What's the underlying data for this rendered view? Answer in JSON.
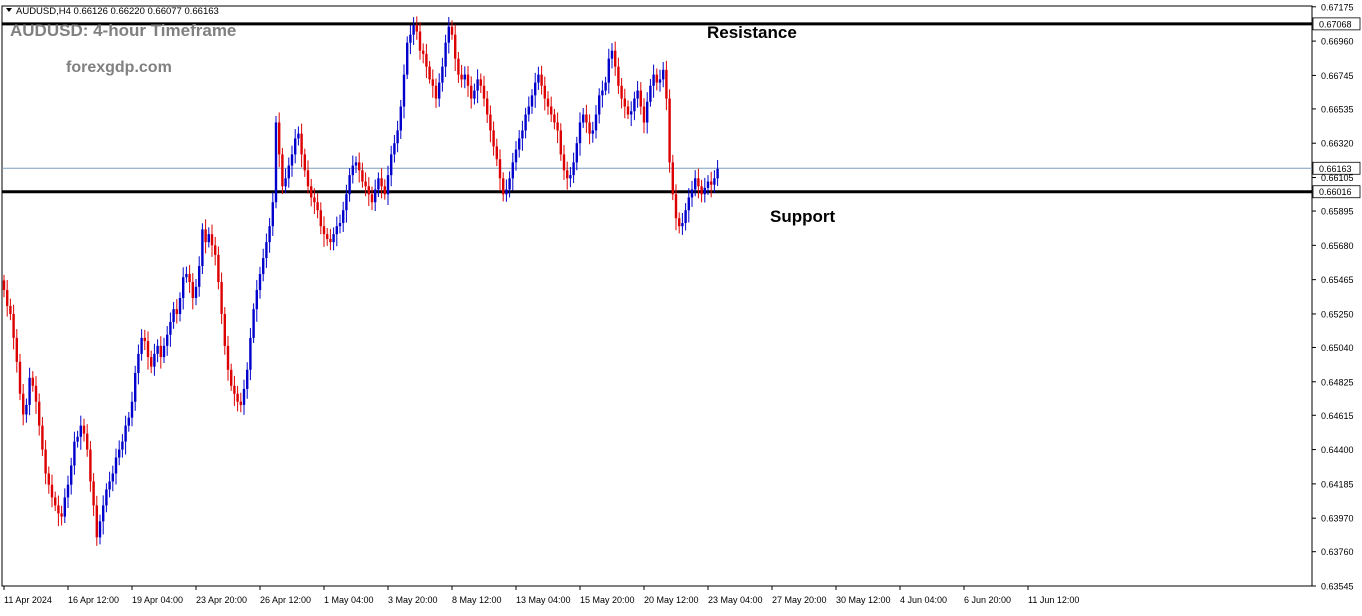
{
  "header": {
    "symbol_line": "AUDUSD,H4  0.66126 0.66220 0.66077 0.66163",
    "chart_title": "AUDUSD: 4-hour Timeframe",
    "watermark": "forexgdp.com"
  },
  "chart_data": {
    "type": "candlestick",
    "symbol": "AUDUSD",
    "timeframe": "H4",
    "ohlc_current": {
      "open": 0.66126,
      "high": 0.6622,
      "low": 0.66077,
      "close": 0.66163
    },
    "ylim": [
      0.63545,
      0.6718
    ],
    "y_ticks": [
      "0.67175",
      "0.66960",
      "0.66745",
      "0.66535",
      "0.66320",
      "0.66105",
      "0.65895",
      "0.65680",
      "0.65465",
      "0.65250",
      "0.65040",
      "0.64825",
      "0.64615",
      "0.64400",
      "0.64185",
      "0.63970",
      "0.63760",
      "0.63545"
    ],
    "x_ticks": [
      "11 Apr 2024",
      "16 Apr 12:00",
      "19 Apr 04:00",
      "23 Apr 20:00",
      "26 Apr 12:00",
      "1 May 04:00",
      "3 May 20:00",
      "8 May 12:00",
      "13 May 04:00",
      "15 May 20:00",
      "20 May 12:00",
      "23 May 04:00",
      "27 May 20:00",
      "30 May 12:00",
      "4 Jun 04:00",
      "6 Jun 20:00",
      "11 Jun 12:00"
    ],
    "x_tick_bar_index": [
      0,
      20,
      40,
      60,
      80,
      100,
      120,
      140,
      160,
      180,
      200,
      220,
      240,
      260,
      280,
      300,
      320
    ],
    "levels": [
      {
        "name": "Resistance",
        "price": 0.67068,
        "label": "0.67068"
      },
      {
        "name": "Support",
        "price": 0.66016,
        "label": "0.66016"
      }
    ],
    "current_price_label": "0.66163",
    "colors": {
      "bull": "#0000cc",
      "bear": "#dd0000",
      "level_line": "#000000",
      "price_line": "#7f9fbf",
      "axis": "#000000"
    },
    "closes": [
      0.654,
      0.653,
      0.6525,
      0.651,
      0.6495,
      0.6475,
      0.6462,
      0.6468,
      0.6485,
      0.648,
      0.647,
      0.6455,
      0.644,
      0.6425,
      0.6418,
      0.641,
      0.6405,
      0.64,
      0.6398,
      0.641,
      0.6418,
      0.643,
      0.6445,
      0.6448,
      0.6455,
      0.645,
      0.644,
      0.642,
      0.6405,
      0.6385,
      0.6395,
      0.6405,
      0.6415,
      0.642,
      0.6425,
      0.6435,
      0.644,
      0.6445,
      0.6455,
      0.646,
      0.647,
      0.6488,
      0.65,
      0.651,
      0.6508,
      0.6498,
      0.6492,
      0.65,
      0.6505,
      0.6498,
      0.6505,
      0.6512,
      0.652,
      0.6528,
      0.6525,
      0.6535,
      0.6548,
      0.655,
      0.6545,
      0.6535,
      0.6542,
      0.6555,
      0.6578,
      0.657,
      0.6575,
      0.6568,
      0.6562,
      0.6545,
      0.6525,
      0.6505,
      0.649,
      0.648,
      0.6475,
      0.647,
      0.6468,
      0.6478,
      0.649,
      0.651,
      0.6528,
      0.654,
      0.655,
      0.656,
      0.657,
      0.658,
      0.6595,
      0.6645,
      0.6625,
      0.6605,
      0.661,
      0.6618,
      0.6625,
      0.6635,
      0.6638,
      0.6625,
      0.6615,
      0.6605,
      0.6598,
      0.6595,
      0.659,
      0.658,
      0.6575,
      0.6572,
      0.657,
      0.6575,
      0.658,
      0.6582,
      0.659,
      0.66,
      0.6612,
      0.6618,
      0.662,
      0.6615,
      0.6608,
      0.6605,
      0.66,
      0.6595,
      0.6603,
      0.661,
      0.6605,
      0.66,
      0.6612,
      0.6625,
      0.6632,
      0.664,
      0.6655,
      0.6675,
      0.6695,
      0.67,
      0.6706,
      0.6702,
      0.669,
      0.6688,
      0.668,
      0.6672,
      0.6668,
      0.666,
      0.667,
      0.668,
      0.6695,
      0.6705,
      0.67,
      0.6685,
      0.6675,
      0.6672,
      0.6675,
      0.6668,
      0.666,
      0.6665,
      0.6672,
      0.6668,
      0.666,
      0.665,
      0.664,
      0.663,
      0.6622,
      0.661,
      0.66,
      0.6603,
      0.661,
      0.662,
      0.6628,
      0.6635,
      0.664,
      0.665,
      0.6655,
      0.6662,
      0.667,
      0.6675,
      0.6668,
      0.666,
      0.6655,
      0.665,
      0.6645,
      0.664,
      0.6625,
      0.6615,
      0.661,
      0.6612,
      0.662,
      0.6632,
      0.6645,
      0.665,
      0.6645,
      0.6638,
      0.664,
      0.665,
      0.6662,
      0.6665,
      0.667,
      0.6685,
      0.669,
      0.668,
      0.6668,
      0.666,
      0.6655,
      0.665,
      0.6652,
      0.666,
      0.6665,
      0.6655,
      0.6645,
      0.6658,
      0.6668,
      0.6675,
      0.667,
      0.6672,
      0.6678,
      0.666,
      0.662,
      0.66,
      0.6585,
      0.658,
      0.6582,
      0.659,
      0.6598,
      0.6603,
      0.661,
      0.6605,
      0.66,
      0.6604,
      0.6608,
      0.6606,
      0.661,
      0.6616
    ]
  }
}
